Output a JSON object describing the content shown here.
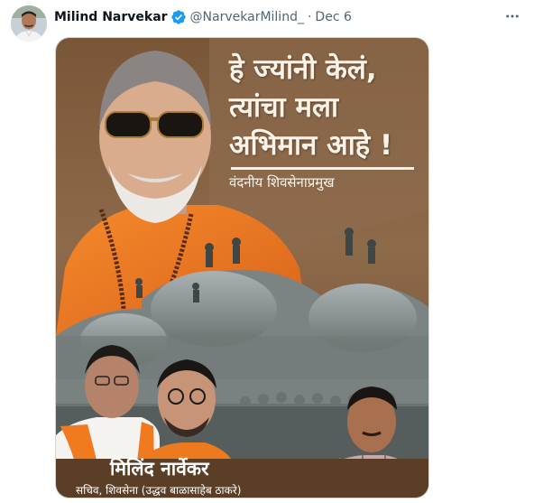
{
  "tweet": {
    "author": {
      "display_name": "Milind Narvekar",
      "handle": "@NarvekarMilind_",
      "verified": true
    },
    "separator": "·",
    "date": "Dec 6",
    "more_icon": "more-horizontal-icon"
  },
  "poster": {
    "headline_lines": [
      "हे ज्यांनी केलं,",
      "त्यांचा मला",
      "अभिमान आहे !"
    ],
    "tagline": "वंदनीय शिवसेनाप्रमुख",
    "name": "मिलिंद नार्वेकर",
    "role": "सचिव, शिवसेना (उद्धव बाळासाहेब ठाकरे)"
  },
  "colors": {
    "verified_badge": "#1d9bf0",
    "secondary_text": "#536471",
    "poster_brown": "#7a5638",
    "saffron": "#f07b1f"
  }
}
